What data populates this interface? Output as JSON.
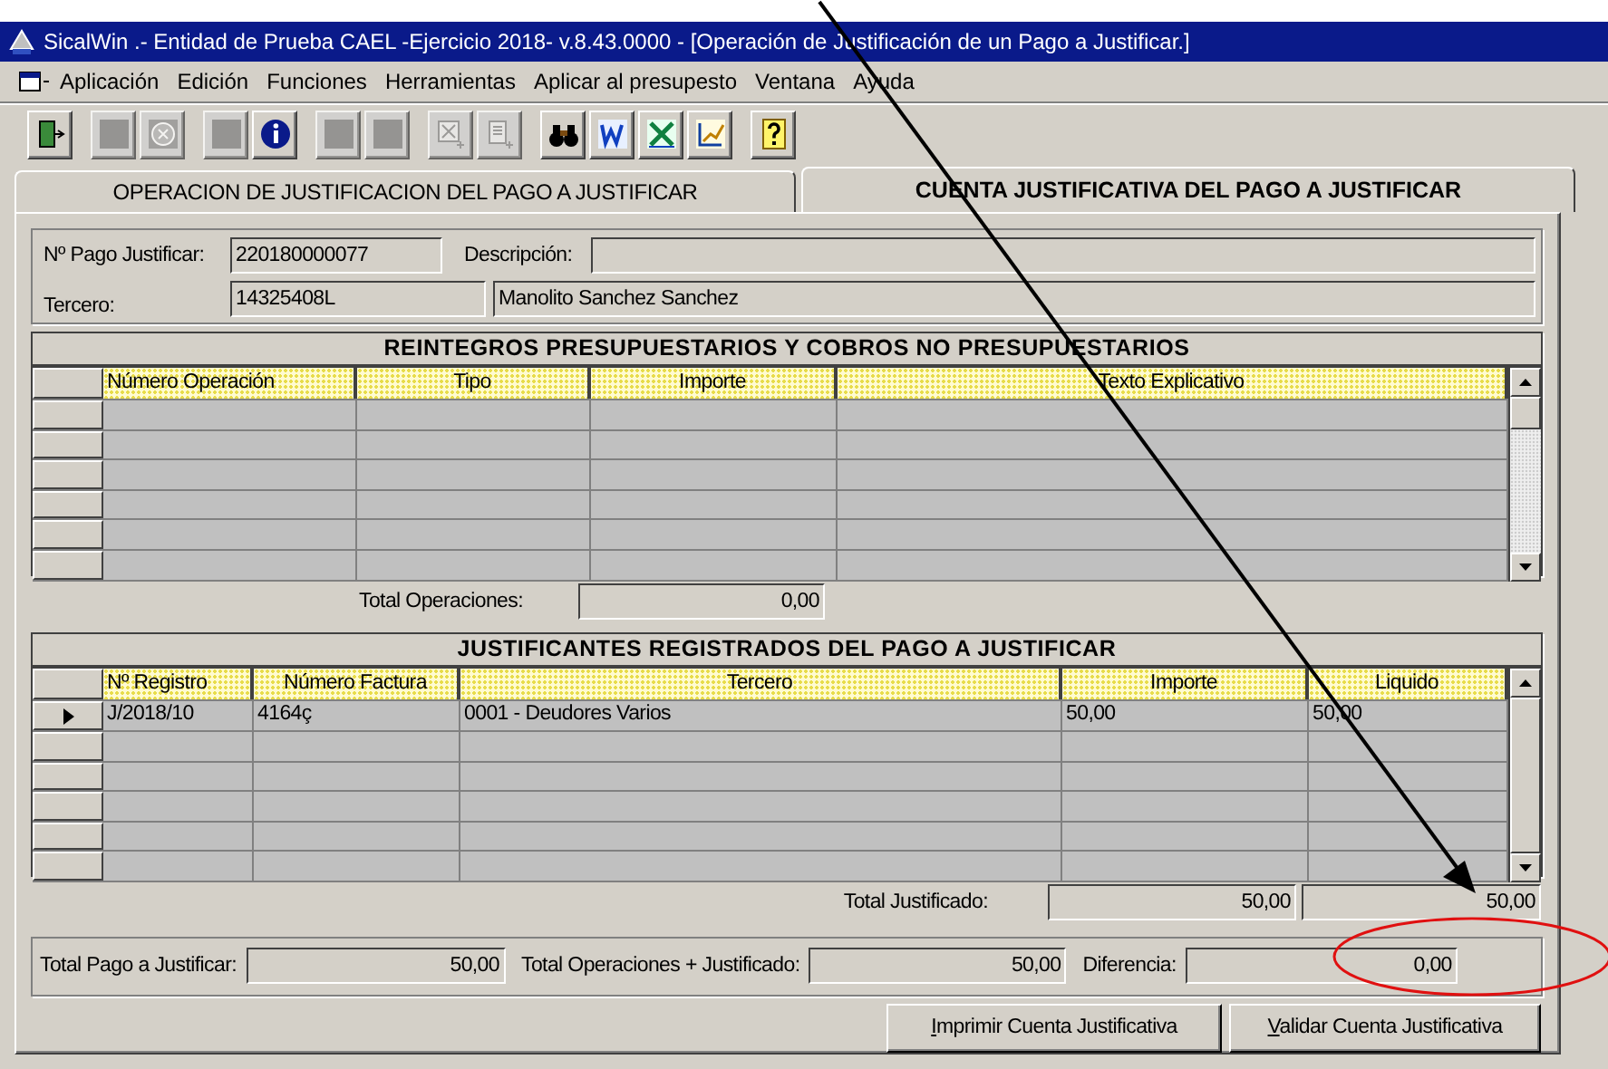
{
  "window": {
    "title": "SicalWin  .- Entidad de Prueba CAEL -Ejercicio 2018- v.8.43.0000 - [Operación de Justificación de un Pago a Justificar.]"
  },
  "menu": [
    "Aplicación",
    "Edición",
    "Funciones",
    "Herramientas",
    "Aplicar al presupesto",
    "Ventana",
    "Ayuda"
  ],
  "toolbar_groups": [
    [
      {
        "kind": "exit",
        "disabled": false
      }
    ],
    [
      {
        "kind": "blank",
        "disabled": true
      },
      {
        "kind": "cancel",
        "disabled": true
      }
    ],
    [
      {
        "kind": "blank",
        "disabled": true
      },
      {
        "kind": "info",
        "disabled": false
      }
    ],
    [
      {
        "kind": "blank",
        "disabled": true
      },
      {
        "kind": "blank",
        "disabled": true
      }
    ],
    [
      {
        "kind": "grid-add",
        "disabled": true
      },
      {
        "kind": "list-add",
        "disabled": true
      }
    ],
    [
      {
        "kind": "binoculars",
        "disabled": false
      },
      {
        "kind": "word",
        "disabled": false
      },
      {
        "kind": "excel",
        "disabled": false
      },
      {
        "kind": "chart",
        "disabled": false
      }
    ],
    [
      {
        "kind": "help",
        "disabled": false
      }
    ]
  ],
  "tabs": [
    {
      "label": "OPERACION DE JUSTIFICACION DEL PAGO A JUSTIFICAR",
      "selected": false
    },
    {
      "label": "CUENTA JUSTIFICATIVA DEL PAGO A JUSTIFICAR",
      "selected": true
    }
  ],
  "payment": {
    "label": "Nº Pago Justificar:",
    "value": "220180000077"
  },
  "description": {
    "label": "Descripción:"
  },
  "third_party": {
    "label": "Tercero:",
    "code": "14325408L",
    "name": "Manolito Sanchez Sanchez"
  },
  "refunds_grid": {
    "title": "REINTEGROS PRESUPUESTARIOS Y COBROS NO PRESUPUESTARIOS",
    "columns": [
      "Número Operación",
      "Tipo",
      "Importe",
      "Texto Explicativo"
    ]
  },
  "total_operations": {
    "label": "Total Operaciones:",
    "value": "0,00"
  },
  "vouchers_grid": {
    "title": "JUSTIFICANTES REGISTRADOS DEL PAGO A JUSTIFICAR",
    "columns": [
      "Nº Registro",
      "Número Factura",
      "Tercero",
      "Importe",
      "Liquido"
    ],
    "rows": [
      {
        "selected": true,
        "cells": [
          "J/2018/10",
          "4164ç",
          "0001 - Deudores Varios",
          "50,00",
          "50,00"
        ]
      }
    ]
  },
  "total_justified": {
    "label": "Total Justificado:",
    "values": [
      "50,00",
      "50,00"
    ]
  },
  "summary": [
    {
      "label": "Total Pago a Justificar:",
      "value": "50,00"
    },
    {
      "label": "Total Operaciones + Justificado:",
      "value": "50,00"
    },
    {
      "label": "Diferencia:",
      "value": "0,00"
    }
  ],
  "buttons": [
    "Imprimir Cuenta Justificativa",
    "Validar Cuenta Justificativa"
  ]
}
